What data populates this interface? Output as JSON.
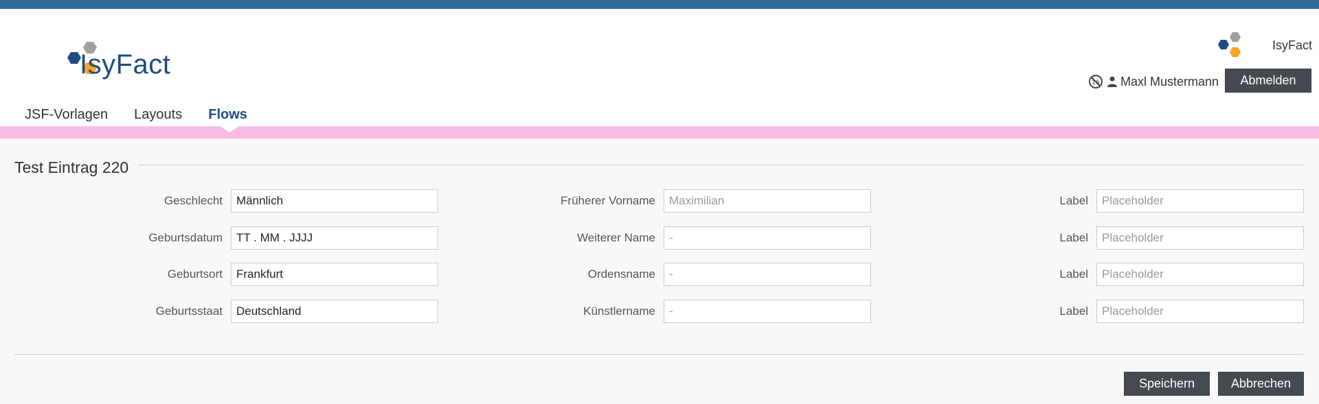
{
  "app": {
    "name": "IsyFact",
    "logo_text": "IsyFact"
  },
  "header": {
    "brand_right": "IsyFact",
    "user_name": "Maxl Mustermann",
    "logout_label": "Abmelden"
  },
  "nav": {
    "items": [
      {
        "label": "JSF-Vorlagen"
      },
      {
        "label": "Layouts"
      },
      {
        "label": "Flows",
        "active": true
      }
    ]
  },
  "section": {
    "title": "Test Eintrag 220"
  },
  "form": {
    "col1": [
      {
        "label": "Geschlecht",
        "value": "Männlich"
      },
      {
        "label": "Geburtsdatum",
        "value": " TT . MM . JJJJ"
      },
      {
        "label": "Geburtsort",
        "value": "Frankfurt"
      },
      {
        "label": "Geburtsstaat",
        "value": "Deutschland"
      }
    ],
    "col2": [
      {
        "label": "Früherer Vorname",
        "placeholder": "Maximilian"
      },
      {
        "label": "Weiterer Name",
        "placeholder": "-"
      },
      {
        "label": "Ordensname",
        "placeholder": "-"
      },
      {
        "label": "Künstlername",
        "placeholder": "-"
      }
    ],
    "col3": [
      {
        "label": "Label",
        "placeholder": "Placeholder"
      },
      {
        "label": "Label",
        "placeholder": "Placeholder"
      },
      {
        "label": "Label",
        "placeholder": "Placeholder"
      },
      {
        "label": "Label",
        "placeholder": "Placeholder"
      }
    ]
  },
  "actions": {
    "save_label": "Speichern",
    "cancel_label": "Abbrechen"
  },
  "colors": {
    "topbar": "#34689a",
    "brand_blue": "#1f4c80",
    "accent_band": "#f9bde3",
    "hex_blue": "#1f4c80",
    "hex_gray": "#a0a0a0",
    "hex_orange": "#f5a623",
    "button_dark": "#444a50"
  },
  "icons": {
    "no_access": "ban-icon",
    "user": "user-icon"
  }
}
